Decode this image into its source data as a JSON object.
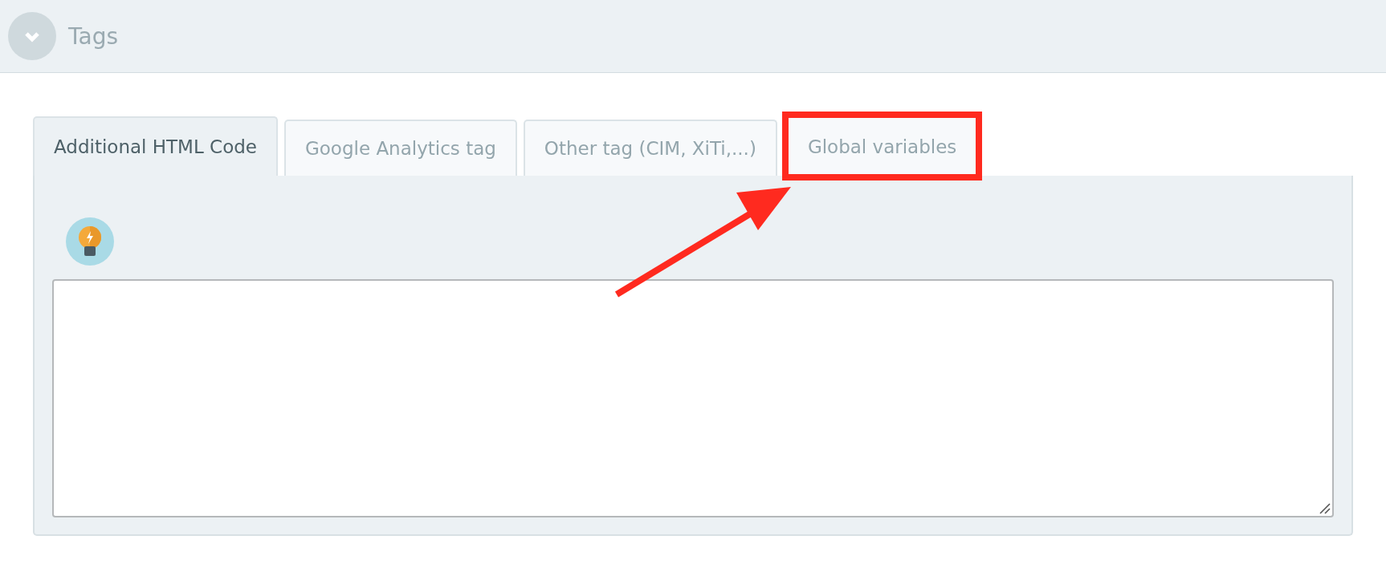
{
  "section": {
    "title": "Tags",
    "expanded": true
  },
  "tabs": [
    {
      "label": "Additional HTML Code",
      "selected": true,
      "highlighted": false
    },
    {
      "label": "Google Analytics tag",
      "selected": false,
      "highlighted": false
    },
    {
      "label": "Other tag (CIM, XiTi,...)",
      "selected": false,
      "highlighted": false
    },
    {
      "label": "Global variables",
      "selected": false,
      "highlighted": true
    }
  ]
}
